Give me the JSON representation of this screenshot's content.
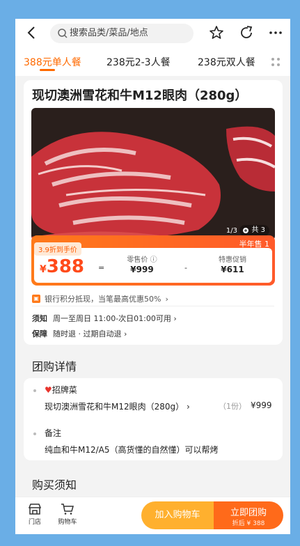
{
  "header": {
    "search_placeholder": "搜索品类/菜品/地点"
  },
  "tabs": [
    {
      "label": "388元单人餐",
      "active": true
    },
    {
      "label": "238元2-3人餐",
      "active": false
    },
    {
      "label": "238元双人餐",
      "active": false
    }
  ],
  "product": {
    "title": "现切澳洲雪花和牛M12眼肉（280g）",
    "pager": "1/3",
    "photo_count": "共 3",
    "sold": "半年售 1",
    "discount": "3.9折到手价",
    "yen": "¥",
    "price": "388",
    "retail_label": "零售价",
    "retail_value": "¥999",
    "promo_label": "特惠促销",
    "promo_value": "¥611",
    "eq": "=",
    "minus": "-"
  },
  "bank_text": "银行积分抵现，当笔最高优惠50%",
  "notice": {
    "key": "须知",
    "value": "周一至周日 11:00-次日01:00可用"
  },
  "guarantee": {
    "key": "保障",
    "value": "随时退 · 过期自动退"
  },
  "group_detail": {
    "title": "团购详情",
    "signature_label": "招牌菜",
    "item_name": "现切澳洲雪花和牛M12眼肉（280g）",
    "item_qty": "（1份）",
    "item_price": "¥999",
    "note_label": "备注",
    "note_text": "纯血和牛M12/A5（高货懂的自然懂）可以帮烤"
  },
  "purchase_notice_title": "购买须知",
  "bottom_bar": {
    "store": "门店",
    "cart": "购物车",
    "add_to_cart": "加入购物车",
    "buy_now": "立即团购",
    "buy_sub": "折后 ¥ 388"
  },
  "colors": {
    "accent": "#ff6a00",
    "price_red": "#ff4a1a",
    "cart_btn": "#ffb02e",
    "buy_btn": "#ff6a1a",
    "frame_blue": "#6aaee6"
  }
}
